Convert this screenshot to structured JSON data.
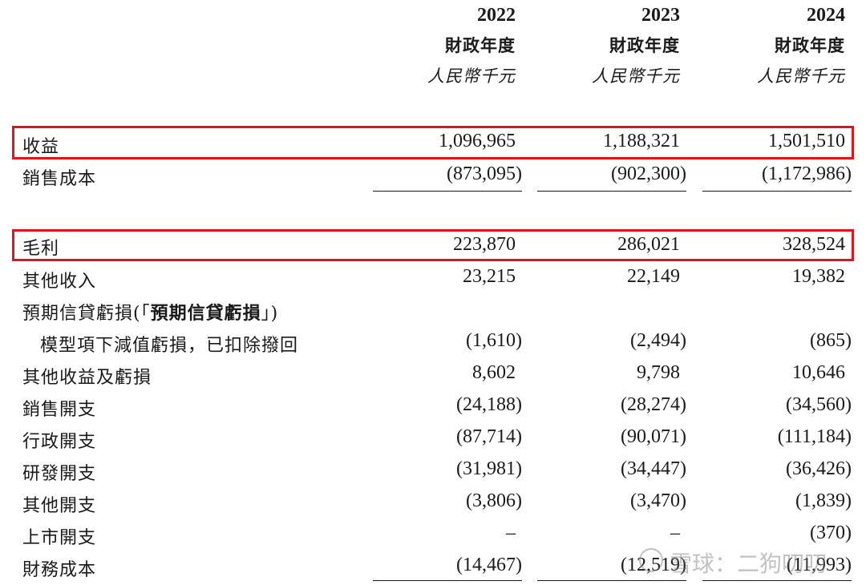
{
  "columns": [
    {
      "year": "2022",
      "period": "財政年度",
      "unit": "人民幣千元"
    },
    {
      "year": "2023",
      "period": "財政年度",
      "unit": "人民幣千元"
    },
    {
      "year": "2024",
      "period": "財政年度",
      "unit": "人民幣千元"
    }
  ],
  "rows": [
    {
      "label": "收益",
      "values": [
        "1,096,965",
        "1,188,321",
        "1,501,510"
      ]
    },
    {
      "label": "銷售成本",
      "values": [
        "(873,095)",
        "(902,300)",
        "(1,172,986)"
      ]
    },
    {
      "label": "毛利",
      "values": [
        "223,870",
        "286,021",
        "328,524"
      ]
    },
    {
      "label": "其他收入",
      "values": [
        "23,215",
        "22,149",
        "19,382"
      ]
    },
    {
      "label_prefix": "預期信貸虧損(「",
      "label_bold": "預期信貸虧損",
      "label_suffix": "」)"
    },
    {
      "label": "模型項下減值虧損，已扣除撥回",
      "values": [
        "(1,610)",
        "(2,494)",
        "(865)"
      ]
    },
    {
      "label": "其他收益及虧損",
      "values": [
        "8,602",
        "9,798",
        "10,646"
      ]
    },
    {
      "label": "銷售開支",
      "values": [
        "(24,188)",
        "(28,274)",
        "(34,560)"
      ]
    },
    {
      "label": "行政開支",
      "values": [
        "(87,714)",
        "(90,071)",
        "(111,184)"
      ]
    },
    {
      "label": "研發開支",
      "values": [
        "(31,981)",
        "(34,447)",
        "(36,426)"
      ]
    },
    {
      "label": "其他開支",
      "values": [
        "(3,806)",
        "(3,470)",
        "(1,839)"
      ]
    },
    {
      "label": "上市開支",
      "values": [
        "–",
        "–",
        "(370)"
      ]
    },
    {
      "label": "財務成本",
      "values": [
        "(14,467)",
        "(12,519)",
        "(11,993)"
      ]
    }
  ],
  "watermark": {
    "text": "雪球：二狗叨叨"
  },
  "colors": {
    "highlight": "#e0141c",
    "text": "#1a1a1a"
  }
}
